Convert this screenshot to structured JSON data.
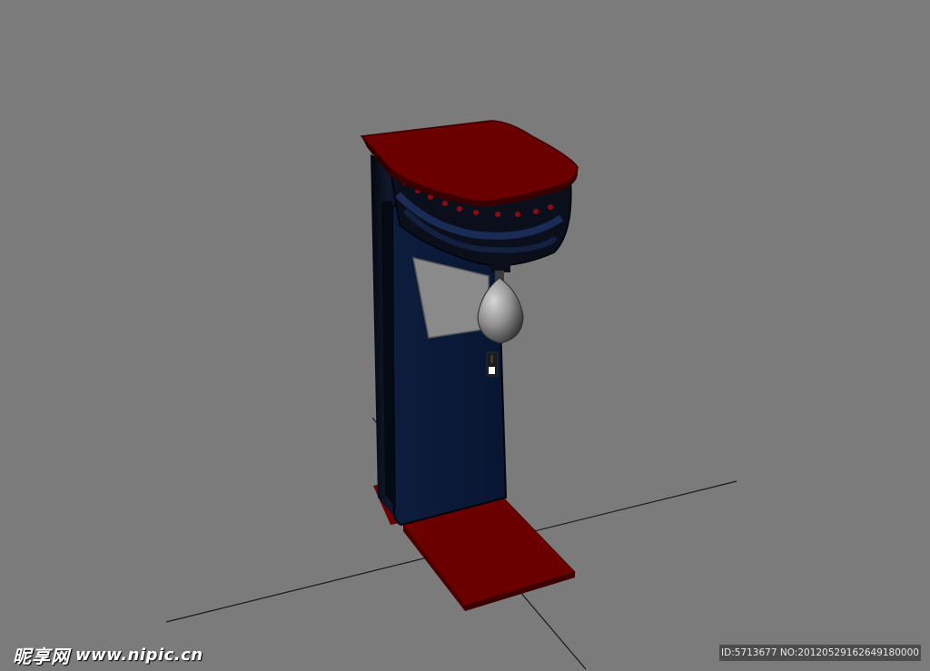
{
  "watermark": {
    "site_name": "昵享网",
    "site_url": "www.nipic.cn",
    "image_info": "ID:5713677 NO:20120529162649180000"
  },
  "colors": {
    "background": "#7b7b7b",
    "cabinet_red": "#6a0000",
    "cabinet_blue": "#0a1a3a",
    "cabinet_dark": "#0b0f1c",
    "panel_gray": "#8a8a8a",
    "bag_gray": "#9a9a9a",
    "grid_line": "#1a1a1a"
  },
  "scene": {
    "object": "boxing-machine-arcade-cabinet",
    "parts": [
      "top-canopy",
      "lamp-ring",
      "back-column",
      "front-panel",
      "display-plate",
      "punching-bag",
      "coin-slot",
      "floor-plate"
    ]
  }
}
